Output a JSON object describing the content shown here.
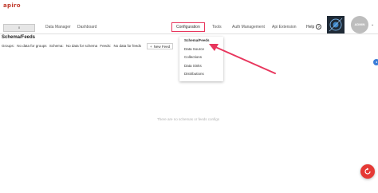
{
  "app": {
    "logo": "apiro",
    "tenant": "0"
  },
  "nav": {
    "data_manager": "Data Manager",
    "dashboard": "Dashboard",
    "configuration": "Configuration",
    "tools": "Tools",
    "auth_management": "Auth Management",
    "api_extension": "Api Extension"
  },
  "header": {
    "help": "Help",
    "help_icon": "?",
    "avatar": "ADMIN",
    "chevron": "⌄"
  },
  "page": {
    "title": "Schema/Feeds",
    "stats": {
      "groups_label": "Groups:",
      "groups_value": "No data for groups",
      "schema_label": "Schema:",
      "schema_value": "No data for schema",
      "feeds_label": "Feeds:",
      "feeds_value": "No data for feeds"
    },
    "new_feed": "New Feed",
    "empty_message": "There are no schemas or feeds configs"
  },
  "dropdown": {
    "items": [
      "Schema/Feeds",
      "Data Source",
      "Collections",
      "Data Sinks",
      "Distributions"
    ]
  },
  "colors": {
    "accent": "#e8365d",
    "fab": "#e53935",
    "logo": "#c0392b"
  },
  "icons": {
    "plus": "+",
    "side": "◂"
  }
}
